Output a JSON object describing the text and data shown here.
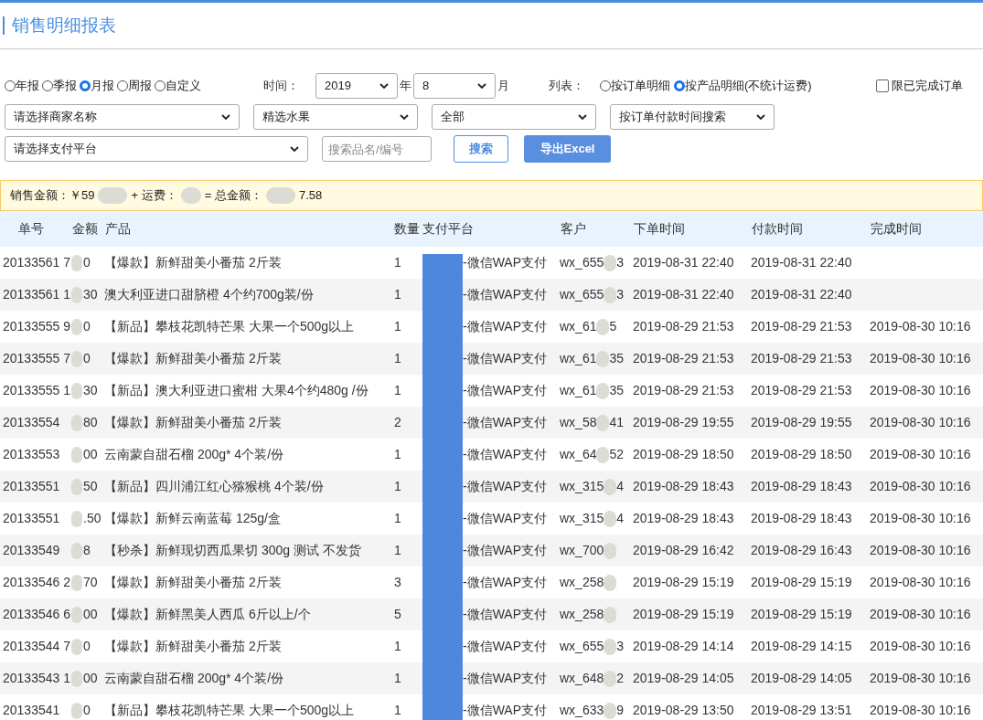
{
  "title": "销售明细报表",
  "period_options": [
    {
      "label": "年报",
      "selected": false
    },
    {
      "label": "季报",
      "selected": false
    },
    {
      "label": "月报",
      "selected": true
    },
    {
      "label": "周报",
      "selected": false
    },
    {
      "label": "自定义",
      "selected": false
    }
  ],
  "time_label": "时间：",
  "year_select": "2019",
  "year_unit": "年",
  "month_select": "8",
  "month_unit": "月",
  "list_label": "列表：",
  "list_options": [
    {
      "label": "按订单明细",
      "selected": false
    },
    {
      "label": "按产品明细(不统计运费)",
      "selected": true
    }
  ],
  "completed_only": {
    "label": "限已完成订单",
    "checked": false
  },
  "merchant_select": "请选择商家名称",
  "category_select": "精选水果",
  "status_select": "全部",
  "time_mode_select": "按订单付款时间搜索",
  "payment_select": "请选择支付平台",
  "search": {
    "placeholder": "搜索品名/编号"
  },
  "search_button": "搜索",
  "export_button": "导出Excel",
  "summary": [
    "销售金额：￥59",
    "+ 运费：",
    "= 总金额：",
    "7.58"
  ],
  "columns": [
    "单号",
    "金额",
    "产品",
    "数量",
    "支付平台",
    "客户",
    "下单时间",
    "付款时间",
    "完成时间"
  ],
  "rows": [
    {
      "order": "20133561 7",
      "amount": "0",
      "product": "【爆款】新鲜甜美小番茄 2斤装",
      "qty": "1",
      "payment": "-微信WAP支付",
      "customer": "wx_655",
      "customer_end": "3",
      "ordered": "2019-08-31 22:40",
      "paid": "2019-08-31 22:40"
    },
    {
      "order": "20133561 1",
      "amount": "30",
      "product": "澳大利亚进口甜脐橙 4个约700g装/份",
      "qty": "1",
      "payment": "-微信WAP支付",
      "customer": "wx_655",
      "customer_end": "3",
      "ordered": "2019-08-31 22:40",
      "paid": "2019-08-31 22:40"
    },
    {
      "order": "20133555 9",
      "amount": "0",
      "product": "【新品】攀枝花凯特芒果 大果一个500g以上",
      "qty": "1",
      "payment": "-微信WAP支付",
      "customer": "wx_61",
      "customer_end": "5",
      "ordered": "2019-08-29 21:53",
      "paid": "2019-08-29 21:53",
      "completed": "2019-08-30 10:16"
    },
    {
      "order": "20133555 7",
      "amount": "0",
      "product": "【爆款】新鲜甜美小番茄 2斤装",
      "qty": "1",
      "payment": "-微信WAP支付",
      "customer": "wx_61",
      "customer_end": "35",
      "ordered": "2019-08-29 21:53",
      "paid": "2019-08-29 21:53",
      "completed": "2019-08-30 10:16"
    },
    {
      "order": "20133555 1",
      "amount": "30",
      "product": "【新品】澳大利亚进口蜜柑 大果4个约480g /份",
      "qty": "1",
      "payment": "-微信WAP支付",
      "customer": "wx_61",
      "customer_end": "35",
      "ordered": "2019-08-29 21:53",
      "paid": "2019-08-29 21:53",
      "completed": "2019-08-30 10:16"
    },
    {
      "order": "20133554",
      "amount": "80",
      "product": "【爆款】新鲜甜美小番茄 2斤装",
      "qty": "2",
      "payment": "-微信WAP支付",
      "customer": "wx_58",
      "customer_end": "41",
      "ordered": "2019-08-29 19:55",
      "paid": "2019-08-29 19:55",
      "completed": "2019-08-30 10:16"
    },
    {
      "order": "20133553",
      "amount": "00",
      "product": "云南蒙自甜石榴 200g* 4个装/份",
      "qty": "1",
      "payment": "-微信WAP支付",
      "customer": "wx_64",
      "customer_end": "52",
      "ordered": "2019-08-29 18:50",
      "paid": "2019-08-29 18:50",
      "completed": "2019-08-30 10:16"
    },
    {
      "order": "20133551",
      "amount": "50",
      "product": "【新品】四川浦江红心猕猴桃 4个装/份",
      "qty": "1",
      "payment": "-微信WAP支付",
      "customer": "wx_315",
      "customer_end": "4",
      "ordered": "2019-08-29 18:43",
      "paid": "2019-08-29 18:43",
      "completed": "2019-08-30 10:16"
    },
    {
      "order": "20133551",
      "amount": ".50",
      "product": "【爆款】新鲜云南蓝莓 125g/盒",
      "qty": "1",
      "payment": "-微信WAP支付",
      "customer": "wx_315",
      "customer_end": "4",
      "ordered": "2019-08-29 18:43",
      "paid": "2019-08-29 18:43",
      "completed": "2019-08-30 10:16"
    },
    {
      "order": "20133549",
      "amount": "8",
      "product": "【秒杀】新鲜现切西瓜果切 300g 测试 不发货",
      "qty": "1",
      "payment": "-微信WAP支付",
      "customer": "wx_700",
      "ordered": "2019-08-29 16:42",
      "paid": "2019-08-29 16:43",
      "completed": "2019-08-30 10:16"
    },
    {
      "order": "20133546 2",
      "amount": "70",
      "product": "【爆款】新鲜甜美小番茄 2斤装",
      "qty": "3",
      "payment": "-微信WAP支付",
      "customer": "wx_258",
      "ordered": "2019-08-29 15:19",
      "paid": "2019-08-29 15:19",
      "completed": "2019-08-30 10:16"
    },
    {
      "order": "20133546 6",
      "amount": "00",
      "product": "【爆款】新鲜黑美人西瓜 6斤以上/个",
      "qty": "5",
      "payment": "-微信WAP支付",
      "customer": "wx_258",
      "ordered": "2019-08-29 15:19",
      "paid": "2019-08-29 15:19",
      "completed": "2019-08-30 10:16"
    },
    {
      "order": "20133544 7",
      "amount": "0",
      "product": "【爆款】新鲜甜美小番茄 2斤装",
      "qty": "1",
      "payment": "-微信WAP支付",
      "customer": "wx_655",
      "customer_end": "3",
      "ordered": "2019-08-29 14:14",
      "paid": "2019-08-29 14:15",
      "completed": "2019-08-30 10:16"
    },
    {
      "order": "20133543 1",
      "amount": "00",
      "product": "云南蒙自甜石榴 200g* 4个装/份",
      "qty": "1",
      "payment": "-微信WAP支付",
      "customer": "wx_648",
      "customer_end": "2",
      "ordered": "2019-08-29 14:05",
      "paid": "2019-08-29 14:05",
      "completed": "2019-08-30 10:16"
    },
    {
      "order": "20133541",
      "amount": "0",
      "product": "【新品】攀枝花凯特芒果 大果一个500g以上",
      "qty": "1",
      "payment": "-微信WAP支付",
      "customer": "wx_633",
      "customer_end": "9",
      "ordered": "2019-08-29 13:50",
      "paid": "2019-08-29 13:51",
      "completed": "2019-08-30 10:16"
    }
  ]
}
